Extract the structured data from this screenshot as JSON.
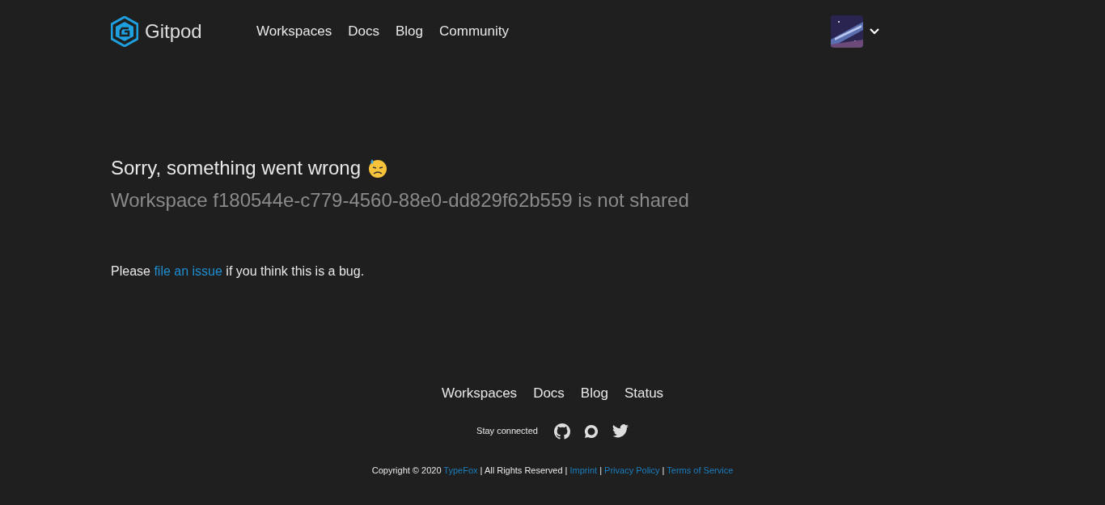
{
  "header": {
    "logo_text": "Gitpod",
    "nav": [
      {
        "label": "Workspaces"
      },
      {
        "label": "Docs"
      },
      {
        "label": "Blog"
      },
      {
        "label": "Community"
      }
    ]
  },
  "error": {
    "title": "Sorry, something went wrong",
    "subtitle": "Workspace f180544e-c779-4560-88e0-dd829f62b559 is not shared",
    "help": [
      {
        "kind": "text",
        "text": "Please "
      },
      {
        "kind": "link",
        "text": "file an issue"
      },
      {
        "kind": "text",
        "text": " if you think this is a bug."
      }
    ]
  },
  "footer": {
    "nav": [
      {
        "label": "Workspaces"
      },
      {
        "label": "Docs"
      },
      {
        "label": "Blog"
      },
      {
        "label": "Status"
      }
    ],
    "social_label": "Stay connected",
    "copyright": [
      {
        "kind": "text",
        "text": "Copyright © 2020 "
      },
      {
        "kind": "link",
        "text": "TypeFox"
      },
      {
        "kind": "text",
        "text": " | All Rights Reserved | "
      },
      {
        "kind": "link",
        "text": "Imprint"
      },
      {
        "kind": "text",
        "text": " | "
      },
      {
        "kind": "link",
        "text": "Privacy Policy"
      },
      {
        "kind": "text",
        "text": " | "
      },
      {
        "kind": "link",
        "text": "Terms of Service"
      }
    ]
  }
}
